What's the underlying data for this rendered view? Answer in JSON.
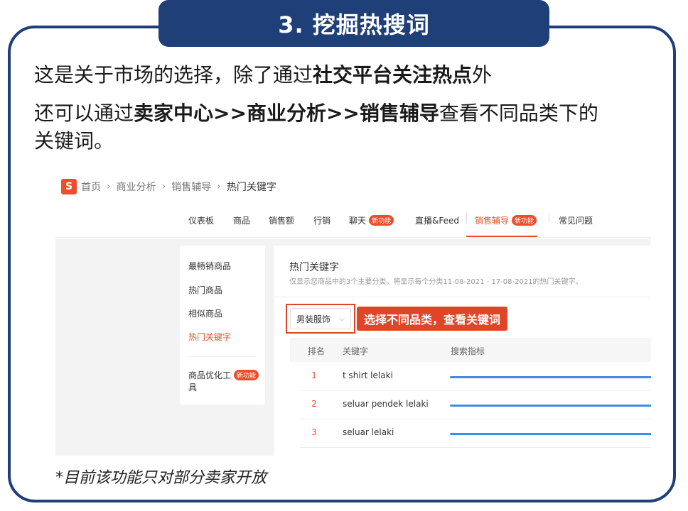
{
  "title": "3. 挖掘热搜词",
  "intro": {
    "line1_a": "这是关于市场的选择，除了通过",
    "line1_b": "社交平台关注热点",
    "line1_c": "外",
    "line2_a": "还可以通过",
    "line2_b": "卖家中心>>商业分析>>销售辅导",
    "line2_c": "查看不同品类下的",
    "line3": "关键词。"
  },
  "screenshot": {
    "logo": "S",
    "breadcrumb": [
      "首页",
      "商业分析",
      "销售辅导",
      "热门关键字"
    ],
    "nav": [
      {
        "label": "仪表板"
      },
      {
        "label": "商品"
      },
      {
        "label": "销售额"
      },
      {
        "label": "行销"
      },
      {
        "label": "聊天",
        "badge": "新功能"
      },
      {
        "label": "直播&Feed"
      },
      {
        "label": "销售辅导",
        "badge": "新功能",
        "active": true
      },
      {
        "label": "常见问题"
      }
    ],
    "side_menu": [
      {
        "label": "最畅销商品"
      },
      {
        "label": "热门商品"
      },
      {
        "label": "相似商品"
      },
      {
        "label": "热门关键字",
        "active": true
      }
    ],
    "side_tool": {
      "label_l1": "商品优化工",
      "label_l2": "具",
      "badge": "新功能"
    },
    "panel": {
      "title": "热门关键字",
      "subtitle": "仅显示您商品中的3个主要分类。将显示每个分类11-08-2021 - 17-08-2021的热门关键字。",
      "dropdown_value": "男装服饰",
      "callout": "选择不同品类，查看关键词",
      "columns": [
        "排名",
        "关键字",
        "搜索指标"
      ],
      "rows": [
        {
          "rank": "1",
          "keyword": "t shirt lelaki"
        },
        {
          "rank": "2",
          "keyword": "seluar pendek lelaki"
        },
        {
          "rank": "3",
          "keyword": "seluar lelaki"
        }
      ]
    }
  },
  "footnote": "*目前该功能只对部分卖家开放",
  "colors": {
    "navy": "#1f3f79",
    "accent": "#ee4d2d",
    "bar": "#3f8ce6"
  }
}
